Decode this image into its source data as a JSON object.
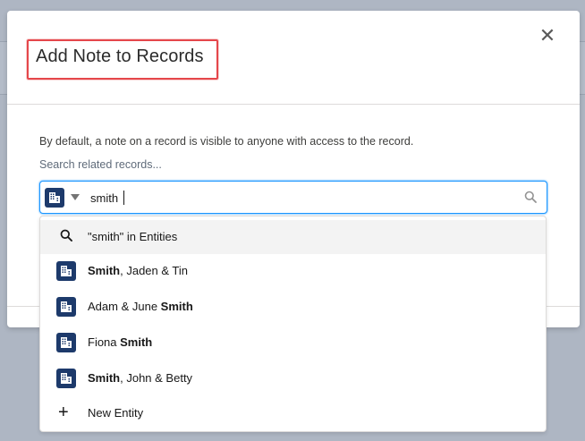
{
  "modal": {
    "title": "Add Note to Records",
    "close_glyph": "✕",
    "helper_text": "By default, a note on a record is visible to anyone with access to the record.",
    "search_label": "Search related records..."
  },
  "combobox": {
    "value": "smith",
    "object_icon": "entity-icon"
  },
  "dropdown": {
    "search_option": "\"smith\" in Entities",
    "results": [
      {
        "bold": "Smith",
        "rest": ", Jaden & Tin",
        "bold_first": true
      },
      {
        "rest": "Adam & June ",
        "bold": "Smith",
        "bold_first": false
      },
      {
        "rest": "Fiona ",
        "bold": "Smith",
        "bold_first": false
      },
      {
        "bold": "Smith",
        "rest": ", John & Betty",
        "bold_first": true
      }
    ],
    "new_label": "New Entity"
  },
  "colors": {
    "accent": "#1b96ff",
    "entity_icon": "#1d3a6b",
    "highlight": "#e5474b"
  }
}
